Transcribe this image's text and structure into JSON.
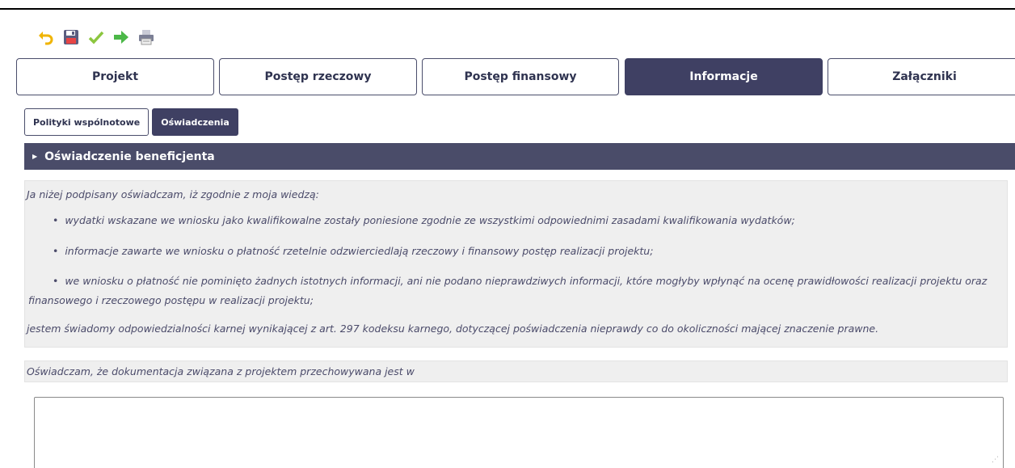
{
  "toolbar": {
    "icons": [
      "undo-icon",
      "save-icon",
      "validate-icon",
      "submit-icon",
      "print-icon"
    ]
  },
  "main_tabs": [
    {
      "label": "Projekt",
      "active": false
    },
    {
      "label": "Postęp rzeczowy",
      "active": false
    },
    {
      "label": "Postęp finansowy",
      "active": false
    },
    {
      "label": "Informacje",
      "active": true
    },
    {
      "label": "Załączniki",
      "active": false
    }
  ],
  "sub_tabs": [
    {
      "label": "Polityki wspólnotowe",
      "active": false
    },
    {
      "label": "Oświadczenia",
      "active": true
    }
  ],
  "section": {
    "title": "Oświadczenie beneficjenta"
  },
  "statement": {
    "intro": "Ja niżej podpisany oświadczam, iż zgodnie z moja wiedzą:",
    "bullets": [
      "wydatki wskazane we wniosku jako kwalifikowalne zostały poniesione zgodnie ze wszystkimi odpowiednimi zasadami kwalifikowania wydatków;",
      "informacje zawarte we wniosku o płatność rzetelnie odzwierciedlają rzeczowy i finansowy postęp realizacji projektu;",
      "we wniosku o płatność nie pominięto żadnych istotnych informacji, ani nie podano nieprawdziwych informacji, które mogłyby wpłynąć na ocenę prawidłowości realizacji projektu oraz finansowego i rzeczowego postępu w realizacji projektu;"
    ],
    "outro": "jestem świadomy odpowiedzialności karnej wynikającej z art. 297 kodeksu karnego, dotyczącej poświadczenia nieprawdy co do okoliczności mającej znaczenie prawne."
  },
  "storage_question": {
    "label": "Oświadczam, że dokumentacja związana z projektem przechowywana jest w",
    "value": ""
  },
  "colors": {
    "accent": "#3f4063",
    "header_bar": "#4a4c69",
    "panel_bg": "#efefef",
    "italic_text": "#4b4b6a"
  }
}
